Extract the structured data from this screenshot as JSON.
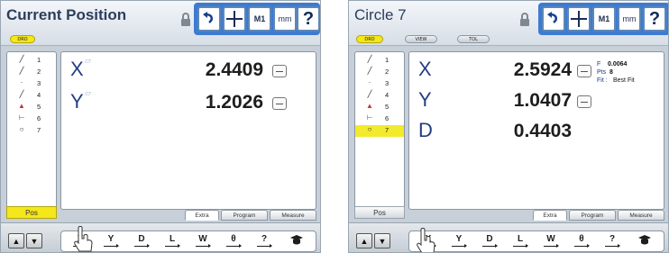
{
  "left": {
    "title": "Current Position",
    "dro_label": "DRO",
    "features": [
      {
        "glyph": "╱",
        "num": "1"
      },
      {
        "glyph": "╱",
        "num": "2"
      },
      {
        "glyph": "·",
        "num": "3"
      },
      {
        "glyph": "╱",
        "num": "4"
      },
      {
        "glyph": "▲",
        "num": "5"
      },
      {
        "glyph": "⊢",
        "num": "6"
      },
      {
        "glyph": "○",
        "num": "7"
      }
    ],
    "pos_label": "Pos",
    "axes": [
      {
        "label": "X",
        "value": "2.4409"
      },
      {
        "label": "Y",
        "value": "1.2026"
      }
    ],
    "tabs": [
      "Extra",
      "Program",
      "Measure"
    ],
    "measure_buttons": [
      "X",
      "Y",
      "D",
      "L",
      "W",
      "θ",
      "?"
    ]
  },
  "right": {
    "title": "Circle 7",
    "dro_label": "DRO",
    "view_label": "VIEW",
    "tol_label": "TOL",
    "features": [
      {
        "glyph": "╱",
        "num": "1"
      },
      {
        "glyph": "╱",
        "num": "2"
      },
      {
        "glyph": "·",
        "num": "3"
      },
      {
        "glyph": "╱",
        "num": "4"
      },
      {
        "glyph": "▲",
        "num": "5"
      },
      {
        "glyph": "⊢",
        "num": "6"
      },
      {
        "glyph": "○",
        "num": "7"
      }
    ],
    "selected_feature": 7,
    "pos_label": "Pos",
    "axes": [
      {
        "label": "X",
        "value": "2.5924"
      },
      {
        "label": "Y",
        "value": "1.0407"
      },
      {
        "label": "D",
        "value": "0.4403"
      }
    ],
    "form_label": "F",
    "form_value": "0.0064",
    "pts_label": "Pts",
    "pts_value": "8",
    "fit_label": "Fit :",
    "fit_value": "Best Fit",
    "tabs": [
      "Extra",
      "Program",
      "Measure"
    ],
    "measure_buttons": [
      "X",
      "Y",
      "D",
      "L",
      "W",
      "θ",
      "?"
    ]
  },
  "toolbar": {
    "m1_label": "M1",
    "mm_label": "mm",
    "help_label": "?"
  },
  "colors": {
    "accent_blue": "#3d7bd0",
    "dro_yellow": "#f4e71a",
    "screen_bg": "#c7cfd8"
  }
}
